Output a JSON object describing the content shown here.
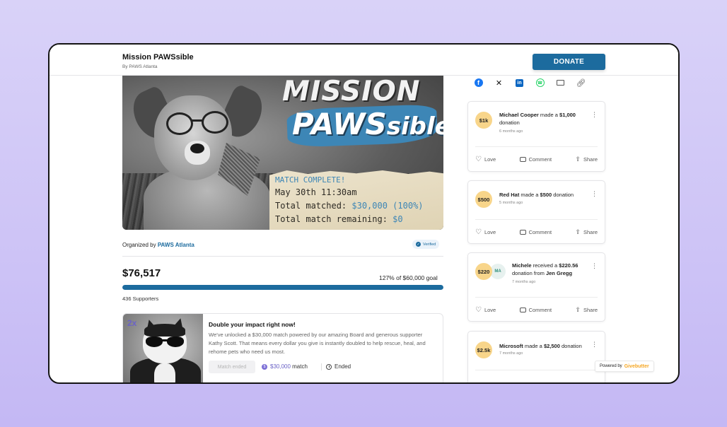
{
  "header": {
    "title": "Mission PAWSsible",
    "byline": "By PAWS Atlanta",
    "donate_label": "DONATE"
  },
  "hero": {
    "logo_line1": "MISSION",
    "logo_line2_main": "PAWS",
    "logo_line2_small": "sible",
    "line1": "MATCH COMPLETE!",
    "line2": "May 30th 11:30am",
    "line3_label": "Total matched: ",
    "line3_value": "$30,000 (100%)",
    "line4_label": "Total match remaining: ",
    "line4_value": "$0"
  },
  "organizer": {
    "prefix": "Organized by ",
    "name": "PAWS Atlanta",
    "verified_label": "Verified"
  },
  "progress": {
    "raised": "$76,517",
    "goal_text": "127% of $60,000 goal",
    "supporters": "436 Supporters",
    "percent": 100
  },
  "match": {
    "badge": "2x",
    "title": "Double your impact right now!",
    "description": "We've unlocked a $30,000 match powered by our amazing Board and generous supporter Kathy Scott. That means every dollar you give is instantly doubled to help rescue, heal, and rehome pets who need us most.",
    "button_label": "Match ended",
    "amount": "$30,000",
    "amount_suffix": " match",
    "status": "Ended"
  },
  "share": [
    "facebook-icon",
    "x-icon",
    "linkedin-icon",
    "whatsapp-icon",
    "mail-icon",
    "link-icon"
  ],
  "feed": [
    {
      "avatar": "$1k",
      "name": "Michael Cooper",
      "verb": " made a ",
      "amount": "$1,000",
      "suffix": " donation",
      "time": "6 months ago"
    },
    {
      "avatar": "$500",
      "name": "Red Hat",
      "verb": " made a ",
      "amount": "$500",
      "suffix": " donation",
      "time": "5 months ago"
    },
    {
      "avatar": "$220",
      "avatar2": "MA",
      "name": "Michele",
      "verb": " received a ",
      "amount": "$220.56",
      "suffix": " donation from ",
      "from": "Jen Gregg",
      "time": "7 months ago"
    },
    {
      "avatar": "$2.5k",
      "name": "Microsoft",
      "verb": " made a ",
      "amount": "$2,500",
      "suffix": " donation",
      "time": "7 months ago"
    }
  ],
  "actions": {
    "love": "Love",
    "comment": "Comment",
    "share": "Share"
  },
  "powered": {
    "prefix": "Powered by",
    "brand": "Givebutter"
  },
  "colors": {
    "brand_blue": "#1c6b9e",
    "match_purple": "#6b63c7",
    "avatar_gold": "#f8d58a"
  }
}
